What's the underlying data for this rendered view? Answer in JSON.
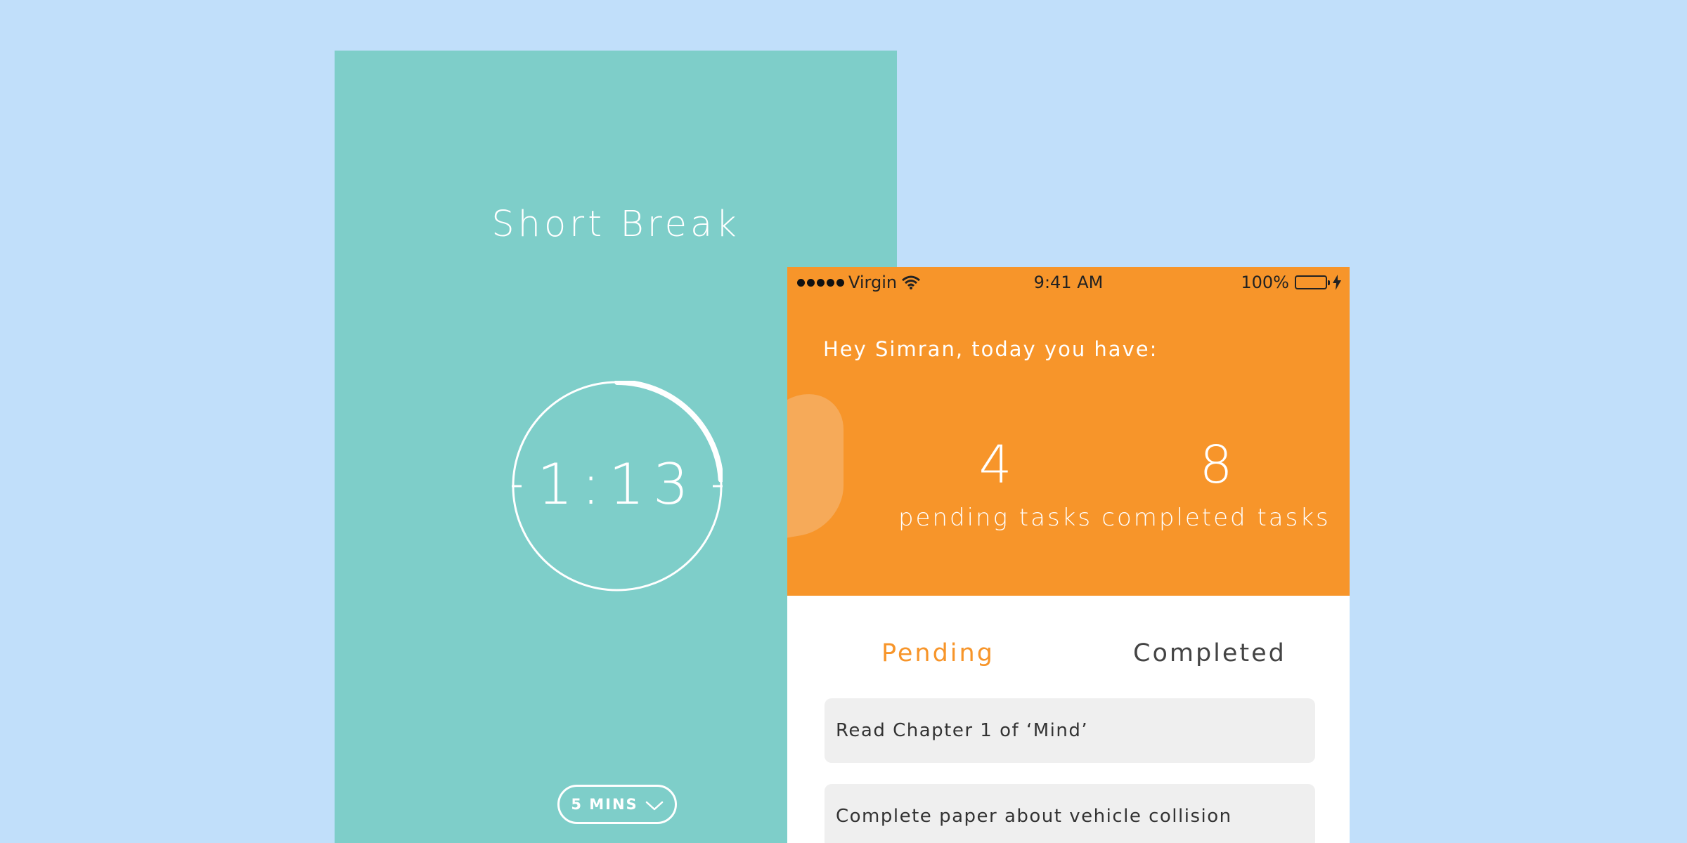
{
  "timer": {
    "title": "Short Break",
    "time": "1:13",
    "duration_label": "5 MINS",
    "progress_fraction": 0.24
  },
  "status_bar": {
    "carrier": "Virgin",
    "time": "9:41 AM",
    "battery": "100%"
  },
  "tasks_screen": {
    "greeting": "Hey Simran, today you have:",
    "stats": {
      "pending_count": "4",
      "pending_label": "pending tasks",
      "completed_count": "8",
      "completed_label": "completed tasks"
    },
    "tabs": [
      {
        "label": "Pending"
      },
      {
        "label": "Completed"
      }
    ],
    "tasks": [
      {
        "title": "Read Chapter 1 of ‘Mind’"
      },
      {
        "title": "Complete paper about vehicle collision"
      }
    ]
  },
  "colors": {
    "background": "#c1dffa",
    "timer_bg": "#7ecec9",
    "accent_orange": "#f7952a",
    "battery_green": "#39e020"
  },
  "icons": [
    "wifi-icon",
    "battery-icon",
    "charging-bolt-icon",
    "chevron-down-icon"
  ]
}
